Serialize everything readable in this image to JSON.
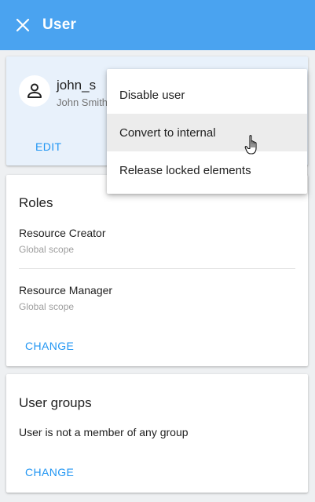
{
  "appbar": {
    "title": "User",
    "close_icon": "close-icon"
  },
  "user_card": {
    "username": "john_s",
    "full_name": "John Smith",
    "edit_label": "EDIT",
    "avatar_icon": "person-icon"
  },
  "roles_card": {
    "title": "Roles",
    "roles": [
      {
        "name": "Resource Creator",
        "scope": "Global scope"
      },
      {
        "name": "Resource Manager",
        "scope": "Global scope"
      }
    ],
    "change_label": "CHANGE"
  },
  "groups_card": {
    "title": "User groups",
    "message": "User is not a member of any group",
    "change_label": "CHANGE"
  },
  "menu": {
    "items": [
      {
        "label": "Disable user"
      },
      {
        "label": "Convert to internal",
        "hovered": true
      },
      {
        "label": "Release locked elements"
      }
    ]
  },
  "colors": {
    "appbar": "#4aa3f0",
    "accent": "#2196f3",
    "user_card_bg": "#e8f1fb"
  }
}
